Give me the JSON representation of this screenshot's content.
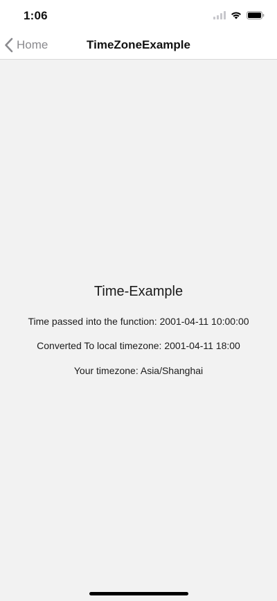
{
  "status_bar": {
    "time": "1:06",
    "icons": [
      "signal-icon",
      "wifi-icon",
      "battery-icon"
    ]
  },
  "nav": {
    "back_label": "Home",
    "title": "TimeZoneExample",
    "back_color": "#8a8a8e"
  },
  "content": {
    "heading": "Time-Example",
    "time_passed": "Time passed into the function: 2001-04-11 10:00:00",
    "converted": "Converted To local timezone: 2001-04-11 18:00",
    "timezone": "Your timezone: Asia/Shanghai"
  },
  "colors": {
    "background": "#f2f2f2",
    "bar_background": "#ffffff"
  }
}
